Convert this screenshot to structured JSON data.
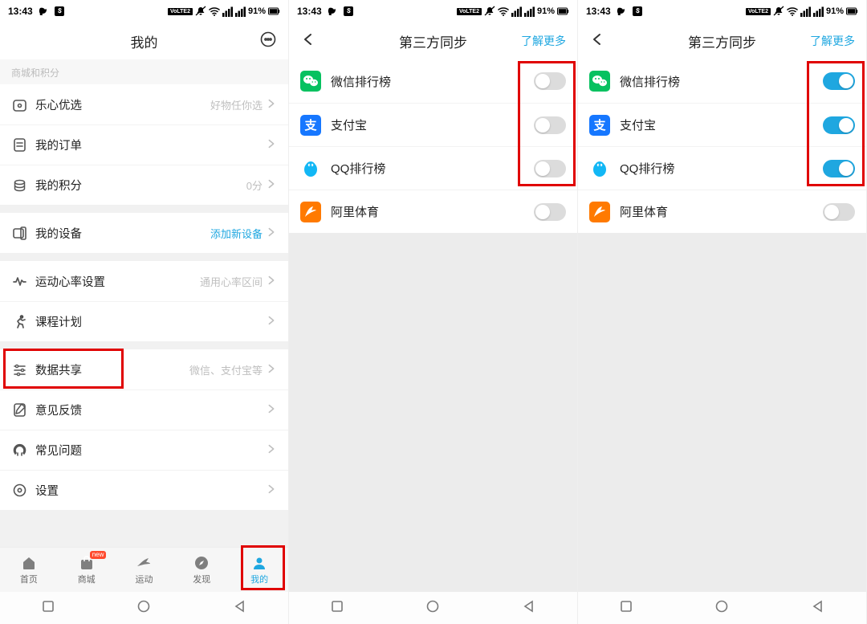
{
  "status": {
    "time": "13:43",
    "battery_text": "91%"
  },
  "screen1": {
    "title": "我的",
    "section_header": "商城和积分",
    "rows": {
      "lexin_select": {
        "label": "乐心优选",
        "sub": "好物任你选"
      },
      "orders": {
        "label": "我的订单"
      },
      "points": {
        "label": "我的积分",
        "sub": "0分"
      },
      "devices": {
        "label": "我的设备",
        "sub": "添加新设备"
      },
      "heartrate": {
        "label": "运动心率设置",
        "sub": "通用心率区间"
      },
      "course": {
        "label": "课程计划"
      },
      "datashare": {
        "label": "数据共享",
        "sub": "微信、支付宝等"
      },
      "feedback": {
        "label": "意见反馈"
      },
      "faq": {
        "label": "常见问题"
      },
      "settings": {
        "label": "设置"
      }
    },
    "tabs": {
      "home": "首页",
      "mall": "商城",
      "sport": "运动",
      "discover": "发现",
      "mine": "我的",
      "mall_badge": "new"
    }
  },
  "sync_screen": {
    "title": "第三方同步",
    "learn_more": "了解更多",
    "items": {
      "wechat": "微信排行榜",
      "alipay": "支付宝",
      "qq": "QQ排行榜",
      "alisport": "阿里体育"
    }
  },
  "screen2": {
    "toggles": {
      "wechat": false,
      "alipay": false,
      "qq": false,
      "alisport": false
    }
  },
  "screen3": {
    "toggles": {
      "wechat": true,
      "alipay": true,
      "qq": true,
      "alisport": false
    }
  }
}
